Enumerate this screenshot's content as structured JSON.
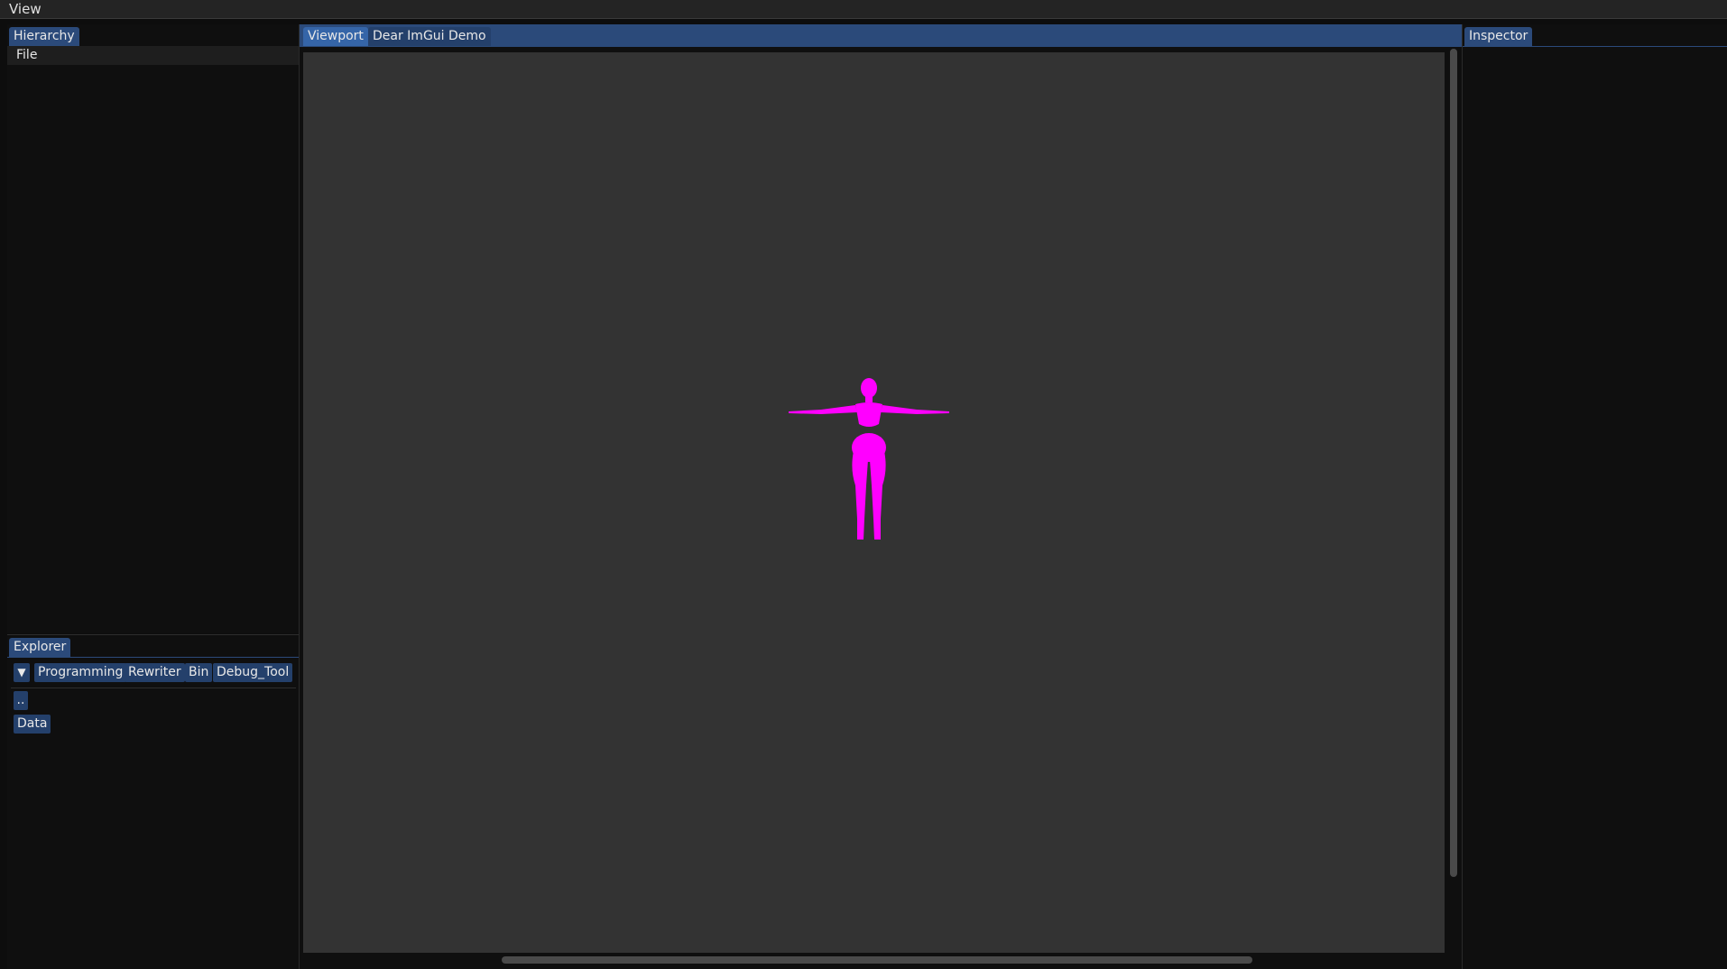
{
  "menubar": {
    "view_label": "View"
  },
  "hierarchy": {
    "tab_label": "Hierarchy",
    "file_label": "File"
  },
  "viewport": {
    "tabs": [
      {
        "label": "Viewport"
      },
      {
        "label": "Dear ImGui Demo"
      }
    ],
    "figure_color": "#ff00ff"
  },
  "inspector": {
    "tab_label": "Inspector"
  },
  "explorer": {
    "tab_label": "Explorer",
    "collapse_glyph": "▼",
    "breadcrumb": [
      {
        "label": "Programming"
      },
      {
        "label": "Rewriter"
      },
      {
        "label": "Bin"
      },
      {
        "label": "Debug_Tool"
      }
    ],
    "up_label": "..",
    "entries": [
      {
        "label": "Data"
      }
    ]
  },
  "colors": {
    "accent": "#2b4a7a",
    "panel_bg": "#0f0f0f",
    "viewport_bg": "#333333"
  }
}
